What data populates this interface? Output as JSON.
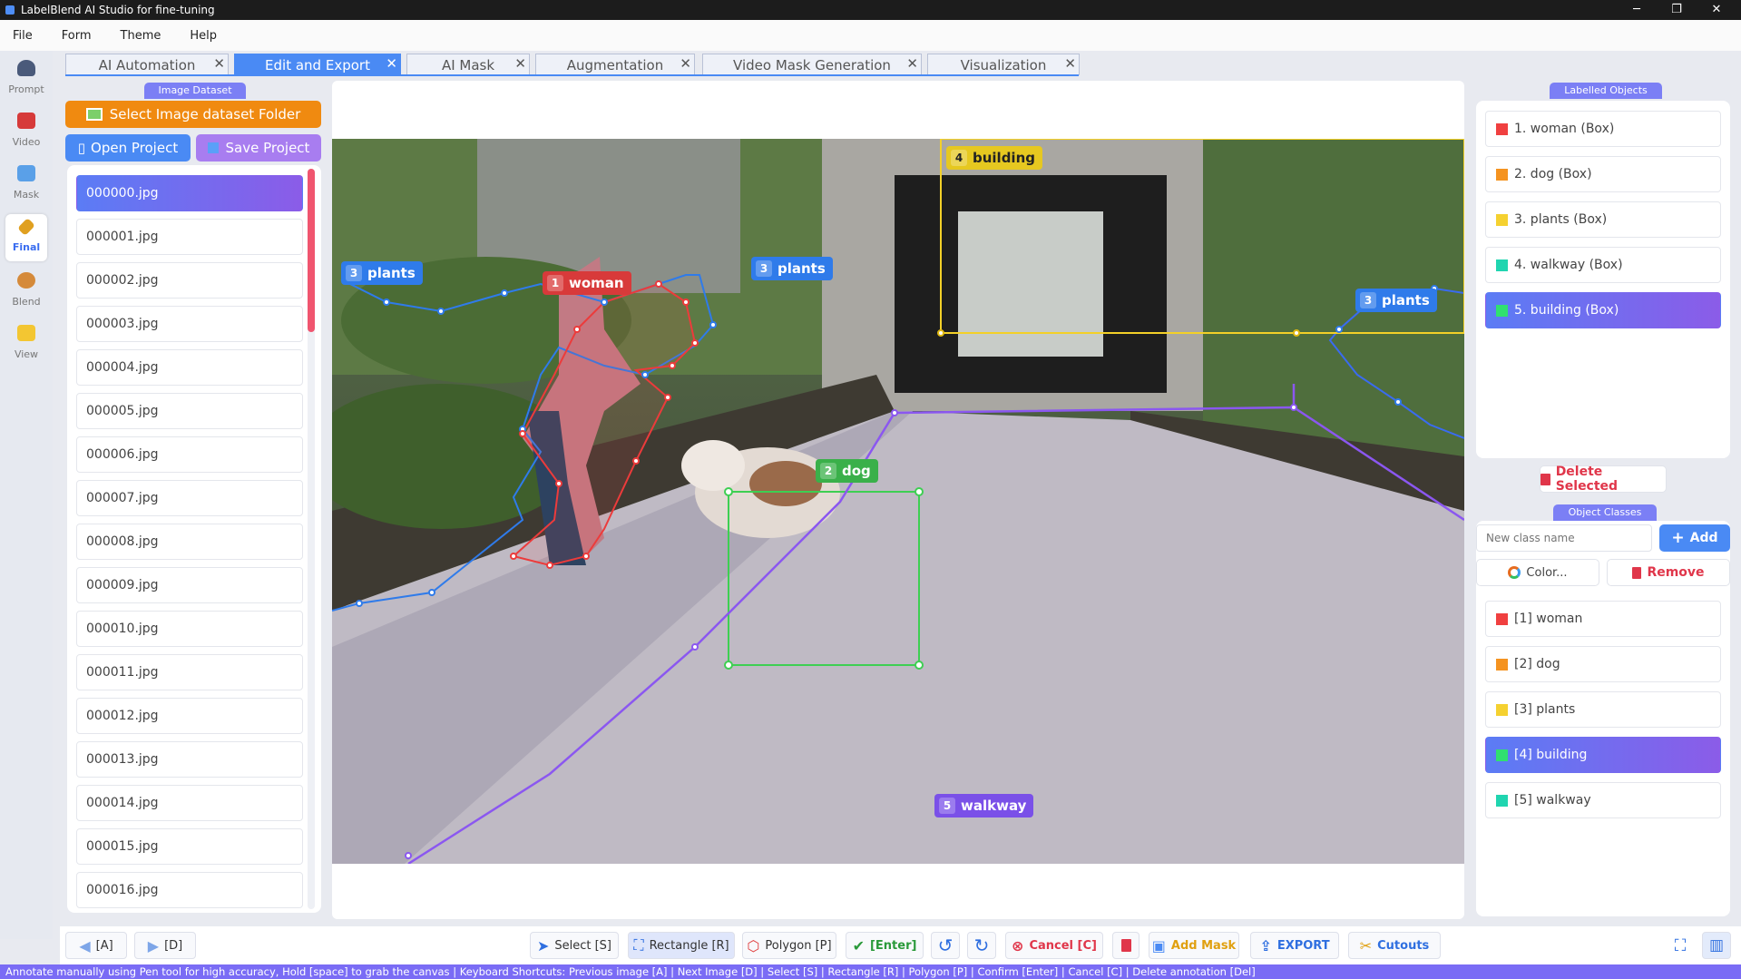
{
  "window": {
    "title": "LabelBlend AI Studio for fine-tuning"
  },
  "menu": [
    "File",
    "Form",
    "Theme",
    "Help"
  ],
  "nav": [
    {
      "label": "Prompt"
    },
    {
      "label": "Video"
    },
    {
      "label": "Mask"
    },
    {
      "label": "Final"
    },
    {
      "label": "Blend"
    },
    {
      "label": "View"
    }
  ],
  "tabs": [
    "AI Automation",
    "Edit and Export",
    "AI Mask",
    "Augmentation",
    "Video Mask Generation",
    "Visualization"
  ],
  "dataset": {
    "group_label": "Image Dataset",
    "select_folder": "Select Image dataset Folder",
    "open_project": "Open Project",
    "save_project": "Save Project",
    "files": [
      "000000.jpg",
      "000001.jpg",
      "000002.jpg",
      "000003.jpg",
      "000004.jpg",
      "000005.jpg",
      "000006.jpg",
      "000007.jpg",
      "000008.jpg",
      "000009.jpg",
      "000010.jpg",
      "000011.jpg",
      "000012.jpg",
      "000013.jpg",
      "000014.jpg",
      "000015.jpg",
      "000016.jpg"
    ],
    "selected_index": 0
  },
  "canvas_labels": [
    {
      "num": "3",
      "text": "plants"
    },
    {
      "num": "1",
      "text": "woman"
    },
    {
      "num": "3",
      "text": "plants"
    },
    {
      "num": "4",
      "text": "building"
    },
    {
      "num": "3",
      "text": "plants"
    },
    {
      "num": "2",
      "text": "dog"
    },
    {
      "num": "5",
      "text": "walkway"
    }
  ],
  "labelled_objects": {
    "group_label": "Labelled Objects",
    "items": [
      {
        "text": "1. woman  (Box)",
        "color": "#f04040"
      },
      {
        "text": "2. dog  (Box)",
        "color": "#f59320"
      },
      {
        "text": "3. plants  (Box)",
        "color": "#f5d130"
      },
      {
        "text": "4. walkway  (Box)",
        "color": "#20d5b0"
      },
      {
        "text": "5. building  (Box)",
        "color": "#30e070"
      }
    ],
    "selected_index": 4,
    "delete_label": "Delete Selected"
  },
  "object_classes": {
    "group_label": "Object Classes",
    "input_placeholder": "New class name",
    "add_label": "Add",
    "color_label": "Color...",
    "remove_label": "Remove",
    "items": [
      {
        "text": "[1]  woman",
        "color": "#f04040"
      },
      {
        "text": "[2]  dog",
        "color": "#f59320"
      },
      {
        "text": "[3]  plants",
        "color": "#f5d130"
      },
      {
        "text": "[4]  building",
        "color": "#30e070"
      },
      {
        "text": "[5]  walkway",
        "color": "#20d5b0"
      }
    ],
    "selected_index": 3
  },
  "toolbar": {
    "prev": "[A]",
    "next": "[D]",
    "select": "Select [S]",
    "rectangle": "Rectangle [R]",
    "polygon": "Polygon [P]",
    "enter": "[Enter]",
    "cancel": "Cancel [C]",
    "add_mask": "Add Mask",
    "export": "EXPORT",
    "cutouts": "Cutouts"
  },
  "status": "Annotate manually using Pen tool for high accuracy, Hold [space] to grab the canvas | Keyboard Shortcuts: Previous image [A] | Next Image [D] | Select [S] | Rectangle [R] | Polygon [P] | Confirm [Enter] | Cancel [C] | Delete annotation [Del]"
}
